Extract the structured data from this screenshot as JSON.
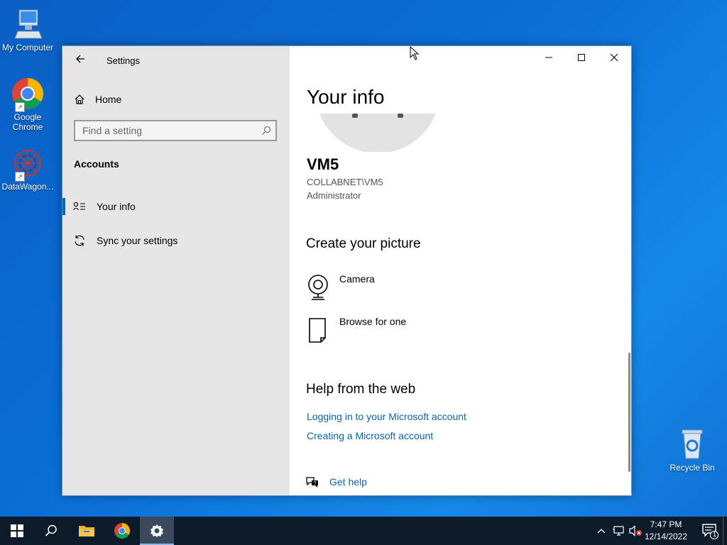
{
  "desktop": {
    "icons": [
      {
        "label": "My Computer",
        "icon": "computer-icon"
      },
      {
        "label": "Google Chrome",
        "icon": "chrome-icon"
      },
      {
        "label": "DataWagon...",
        "icon": "datawagon-icon"
      },
      {
        "label": "Recycle Bin",
        "icon": "recycle-bin-icon"
      }
    ]
  },
  "window": {
    "title": "Settings",
    "controls": [
      "minimize",
      "maximize",
      "close"
    ]
  },
  "sidebar": {
    "home_label": "Home",
    "search_placeholder": "Find a setting",
    "section_title": "Accounts",
    "items": [
      {
        "label": "Your info",
        "icon": "person-list-icon",
        "active": true
      },
      {
        "label": "Sync your settings",
        "icon": "sync-icon",
        "active": false
      }
    ]
  },
  "main": {
    "title": "Your info",
    "user": {
      "name": "VM5",
      "domain_account": "COLLABNET\\VM5",
      "role": "Administrator"
    },
    "create_picture": {
      "heading": "Create your picture",
      "options": [
        {
          "label": "Camera",
          "icon": "camera-icon"
        },
        {
          "label": "Browse for one",
          "icon": "file-icon"
        }
      ]
    },
    "help": {
      "heading": "Help from the web",
      "links": [
        "Logging in to your Microsoft account",
        "Creating a Microsoft account"
      ],
      "get_help": "Get help"
    }
  },
  "taskbar": {
    "time": "7:47 PM",
    "date": "12/14/2022",
    "notification_count": "1",
    "pinned": [
      "start-icon",
      "search-icon",
      "file-explorer-icon",
      "chrome-icon",
      "settings-icon"
    ]
  },
  "colors": {
    "accent": "#0067c0",
    "link": "#0a64ad",
    "sidebar_bg": "#e6e6e6",
    "taskbar_bg": "#0c1a2a"
  }
}
